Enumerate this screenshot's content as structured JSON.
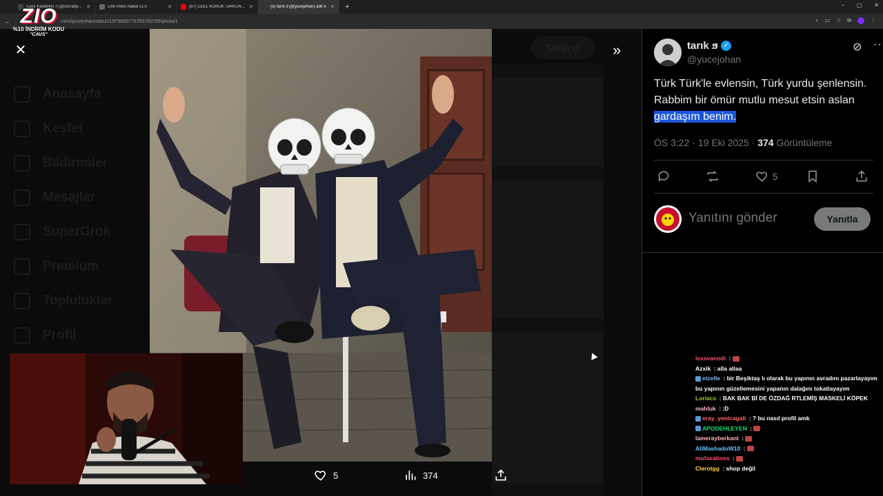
{
  "browser": {
    "tabs": [
      {
        "title": "Cavs Karahlinli :r (@cerrahpasa",
        "active": false,
        "fav": "#444"
      },
      {
        "title": "Link Polisi Hakat v1.0",
        "active": false,
        "fav": "#666"
      },
      {
        "title": "(87) ÖZEL KONUK: ORKUN ÖZ",
        "active": false,
        "fav": "#e00"
      },
      {
        "title": "(5) tarık ϧ (@yucejohan) adlı k",
        "active": true,
        "fav": "#333"
      }
    ],
    "url": ".com/yucejohan/status/1979885779783700789/photo/1"
  },
  "logo": {
    "brand": "ZIO",
    "promo": "%10 İNDİRİM KODU",
    "code": "\"CAVS\""
  },
  "viewer": {
    "dim_nav": [
      "Anasayfa",
      "Keşfet",
      "Bildirimler",
      "Mesajlar",
      "SuperGrok",
      "Premium",
      "Topluluklar",
      "Profil"
    ],
    "follow_label": "Takip et",
    "likes": "5",
    "views": "374"
  },
  "post": {
    "name": "tarık ϧ",
    "handle": "@yucejohan",
    "text_main": "Türk Türk'le evlensin, Türk yurdu şenlensin. Rabbim bir ömür mutlu mesut etsin aslan ",
    "text_highlight": "gardaşım benim.",
    "time": "ÖS 3:22 · 19 Eki 2025 · ",
    "views": "374",
    "views_label": " Görüntüleme",
    "like_count": "5",
    "reply_placeholder": "Yanıtını gönder",
    "reply_button": "Yanıtla"
  },
  "chat": [
    {
      "user": "lexsvanndi",
      "color": "#ff4f6d",
      "text": "",
      "emote": true,
      "badge": false
    },
    {
      "user": "Azxik",
      "color": "#ffffff",
      "text": "alla allaa",
      "emote": false,
      "badge": false
    },
    {
      "user": "etzelle",
      "color": "#8ab4f8",
      "text": "bir Beşiktaş lı olarak bu yapının avradını pazarlayayım bu yapının güzellemesini yapanın dalağını tokatlayayım",
      "emote": false,
      "badge": true
    },
    {
      "user": "Loriacs",
      "color": "#9acd32",
      "text": "BAK BAK Bİ DE ÖZDAĞ RTLEMİŞ MASKELİ KÖPEK",
      "emote": false,
      "badge": false
    },
    {
      "user": "mahluk",
      "color": "#ffb6c1",
      "text": ":D",
      "emote": false,
      "badge": false
    },
    {
      "user": "eray_yenicagali",
      "color": "#ff6b6b",
      "text": "? bu nasıl profil amk",
      "emote": false,
      "badge": true
    },
    {
      "user": "APODEHLEYEN",
      "color": "#00e676",
      "text": "",
      "emote": true,
      "badge": true
    },
    {
      "user": "lamerayberkant",
      "color": "#ffb6c1",
      "text": "",
      "emote": true,
      "badge": false
    },
    {
      "user": "AliMashadoW10",
      "color": "#6ec6ff",
      "text": "",
      "emote": true,
      "badge": false
    },
    {
      "user": "mufasaboss",
      "color": "#ff4f6d",
      "text": "",
      "emote": true,
      "badge": false
    },
    {
      "user": "Clerotgg",
      "color": "#ffd54f",
      "text": "shop değil",
      "emote": false,
      "badge": false
    }
  ],
  "colors": {
    "accent": "#1d9bf0",
    "highlight": "#1a56db"
  }
}
